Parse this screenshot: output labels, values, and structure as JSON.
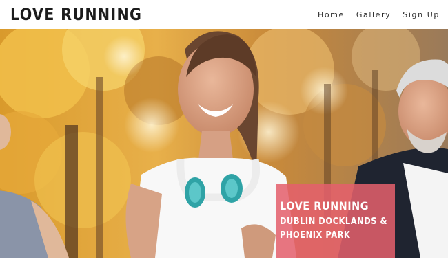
{
  "header": {
    "logo": "LOVE RUNNING",
    "nav": [
      {
        "label": "Home",
        "active": true
      },
      {
        "label": "Gallery",
        "active": false
      },
      {
        "label": "Sign Up",
        "active": false
      }
    ]
  },
  "hero": {
    "overlay": {
      "title": "LOVE RUNNING",
      "subtitle_line1": "DUBLIN DOCKLANDS &",
      "subtitle_line2": "PHOENIX PARK"
    },
    "overlay_color": "#e45f6c"
  }
}
